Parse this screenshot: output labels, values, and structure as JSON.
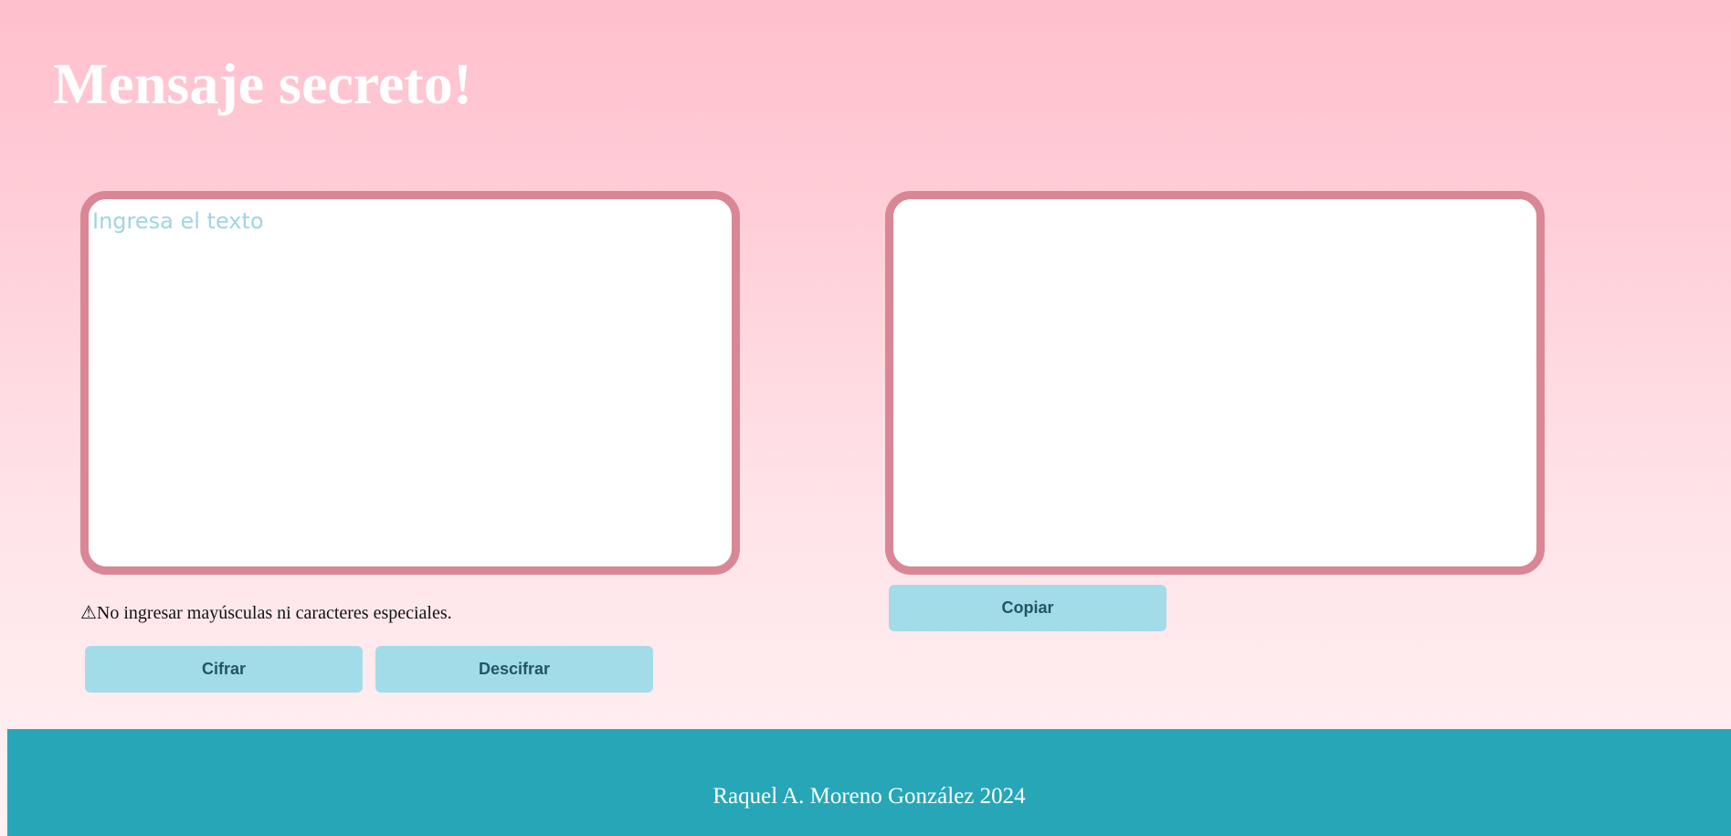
{
  "header": {
    "title": "Mensaje secreto!"
  },
  "input_area": {
    "placeholder": "Ingresa el texto",
    "value": ""
  },
  "output_area": {
    "value": ""
  },
  "warning": {
    "icon": "warning-icon",
    "text": "⚠No ingresar mayúsculas ni caracteres especiales."
  },
  "buttons": {
    "cifrar": "Cifrar",
    "descifrar": "Descifrar",
    "copiar": "Copiar"
  },
  "footer": {
    "text": "Raquel A. Moreno González 2024"
  },
  "colors": {
    "background_top": "#ffbfcc",
    "background_bottom": "#fff2f4",
    "textarea_border": "#d98695",
    "placeholder": "#9fd5e3",
    "button_bg": "#a3dce9",
    "button_text": "#225566",
    "footer_bg": "#27a6b8"
  }
}
